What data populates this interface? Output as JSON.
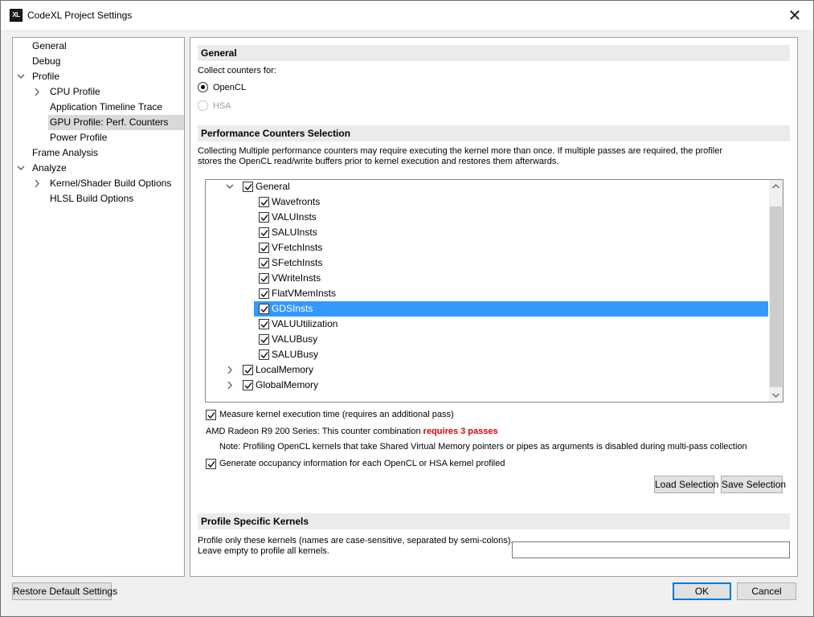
{
  "window": {
    "title": "CodeXL Project Settings",
    "icon_label": "XL"
  },
  "tree": {
    "items": [
      {
        "label": "General",
        "expander": "none"
      },
      {
        "label": "Debug",
        "expander": "none"
      },
      {
        "label": "Profile",
        "expander": "expanded"
      },
      {
        "label": "CPU Profile",
        "expander": "collapsed"
      },
      {
        "label": "Application Timeline Trace",
        "expander": "none"
      },
      {
        "label": "GPU Profile: Perf. Counters",
        "expander": "none",
        "selected": true
      },
      {
        "label": "Power Profile",
        "expander": "none"
      },
      {
        "label": "Frame Analysis",
        "expander": "none"
      },
      {
        "label": "Analyze",
        "expander": "expanded"
      },
      {
        "label": "Kernel/Shader Build Options",
        "expander": "collapsed"
      },
      {
        "label": "HLSL Build Options",
        "expander": "none"
      }
    ]
  },
  "general_section": {
    "header": "General",
    "collect_label": "Collect counters for:",
    "radio_opencl": "OpenCL",
    "radio_hsa": "HSA",
    "opencl_selected": true,
    "hsa_enabled": false
  },
  "perf_section": {
    "header": "Performance Counters Selection",
    "description_line1": "Collecting Multiple performance counters may require executing the kernel more than once. If multiple passes are required, the profiler",
    "description_line2": "stores the OpenCL read/write buffers prior to kernel execution and restores them afterwards.",
    "counter_groups": [
      {
        "label": "General",
        "expanded": true,
        "checked": true
      },
      {
        "label": "LocalMemory",
        "expanded": false,
        "checked": true
      },
      {
        "label": "GlobalMemory",
        "expanded": false,
        "checked": true
      }
    ],
    "general_counters": [
      {
        "label": "Wavefronts",
        "checked": true
      },
      {
        "label": "VALUInsts",
        "checked": true
      },
      {
        "label": "SALUInsts",
        "checked": true
      },
      {
        "label": "VFetchInsts",
        "checked": true
      },
      {
        "label": "SFetchInsts",
        "checked": true
      },
      {
        "label": "VWriteInsts",
        "checked": true
      },
      {
        "label": "FlatVMemInsts",
        "checked": true
      },
      {
        "label": "GDSInsts",
        "checked": true,
        "selected": true
      },
      {
        "label": "VALUUtilization",
        "checked": true
      },
      {
        "label": "VALUBusy",
        "checked": true
      },
      {
        "label": "SALUBusy",
        "checked": true
      }
    ],
    "measure_time_label": "Measure kernel execution time (requires an additional pass)",
    "measure_time_checked": true,
    "passes_prefix": "AMD Radeon R9 200 Series: This counter combination ",
    "passes_emphasis": "requires 3 passes",
    "note": "Note: Profiling OpenCL kernels that take Shared Virtual Memory pointers or pipes as arguments is disabled during multi-pass collection",
    "occupancy_label": "Generate occupancy information for each OpenCL or HSA kernel profiled",
    "occupancy_checked": true,
    "load_button": "Load Selection",
    "save_button": "Save Selection"
  },
  "kernels_section": {
    "header": "Profile Specific Kernels",
    "description_line1": "Profile only these kernels (names are case-sensitive, separated by semi-colons).",
    "description_line2": "Leave empty to profile all kernels.",
    "input_value": ""
  },
  "footer": {
    "restore_button": "Restore Default Settings",
    "ok_button": "OK",
    "cancel_button": "Cancel"
  },
  "colors": {
    "selection_blue": "#3399ff",
    "tree_selection_gray": "#d9d9d9",
    "passes_red": "#e00000",
    "section_header_bg": "#ebebeb"
  }
}
